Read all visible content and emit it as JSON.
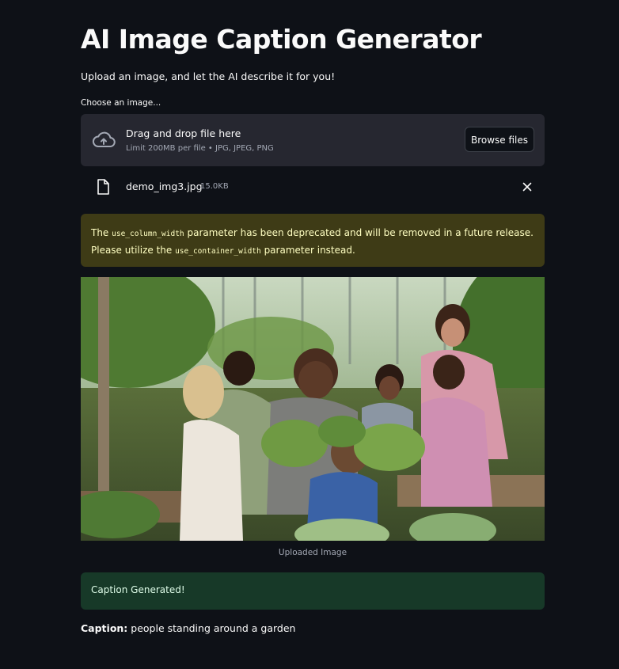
{
  "header": {
    "title": "AI Image Caption Generator",
    "subtitle": "Upload an image, and let the AI describe it for you!"
  },
  "uploader": {
    "label": "Choose an image...",
    "drop_title": "Drag and drop file here",
    "drop_limit": "Limit 200MB per file • JPG, JPEG, PNG",
    "browse_label": "Browse files",
    "icon": "cloud-upload-icon"
  },
  "uploaded_file": {
    "name": "demo_img3.jpg",
    "size": "15.0KB",
    "icon": "file-icon",
    "remove_icon": "close-icon"
  },
  "warning": {
    "text_1": "The ",
    "code_1": "use_column_width",
    "text_2": " parameter has been deprecated and will be removed in a future release. Please utilize the ",
    "code_2": "use_container_width",
    "text_3": " parameter instead."
  },
  "image": {
    "caption": "Uploaded Image"
  },
  "result": {
    "status": "Caption Generated!",
    "caption_label": "Caption:",
    "caption_text": " people standing around a garden"
  },
  "colors": {
    "background": "#0e1117",
    "dropzone": "#262730",
    "warning_bg": "#3e3b16",
    "warning_text": "#ffffc2",
    "success_bg": "#173928",
    "success_text": "#dffde9"
  }
}
